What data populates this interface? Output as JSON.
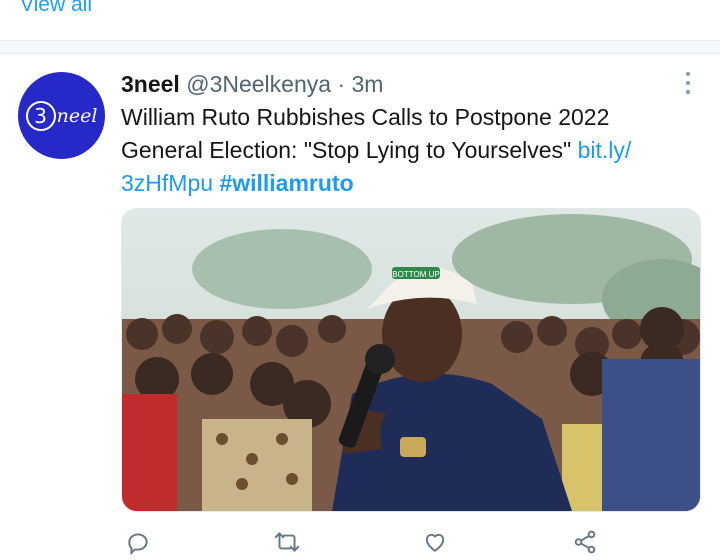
{
  "top": {
    "view_all_label": "View all"
  },
  "tweet": {
    "avatar_digit": "3",
    "avatar_word": "neel",
    "display_name": "3neel",
    "handle": "@3Neelkenya",
    "separator": "·",
    "time": "3m",
    "text_before_link": "William Ruto Rubbishes Calls to Postpone 2022 General Election: \"Stop Lying to Yourselves\" ",
    "link_text": "bit.ly/ 3zHfMpu",
    "hashtag": "#williamruto",
    "cap_logo_text": "BOTTOM UP"
  },
  "actions": [
    "reply-icon",
    "retweet-icon",
    "like-icon",
    "share-icon"
  ],
  "colors": {
    "link": "#1d9bf0",
    "avatar_bg": "#2629c7",
    "secondary_text": "#536471",
    "icon_gray": "#657786"
  }
}
